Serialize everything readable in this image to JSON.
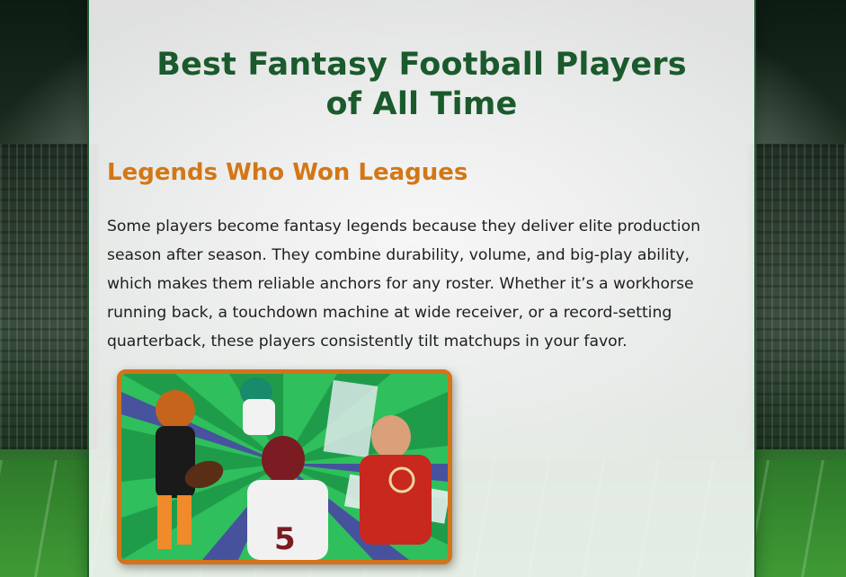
{
  "page": {
    "title": "Best Fantasy Football Players of All Time"
  },
  "section": {
    "heading": "Legends Who Won Leagues",
    "paragraph": "Some players become fantasy legends because they deliver elite production season after season. They combine durability, volume, and big-play ability, which makes them reliable anchors for any roster. Whether it’s a workhorse running back, a touchdown machine at wide receiver, or a record-setting quarterback, these players consistently tilt matchups in your favor."
  },
  "image": {
    "alt_semantic": "collage-of-football-players-icon"
  },
  "colors": {
    "title": "#1a5a2c",
    "heading": "#d37716",
    "card_border": "#1d5e2e",
    "image_border": "#d3731a"
  }
}
